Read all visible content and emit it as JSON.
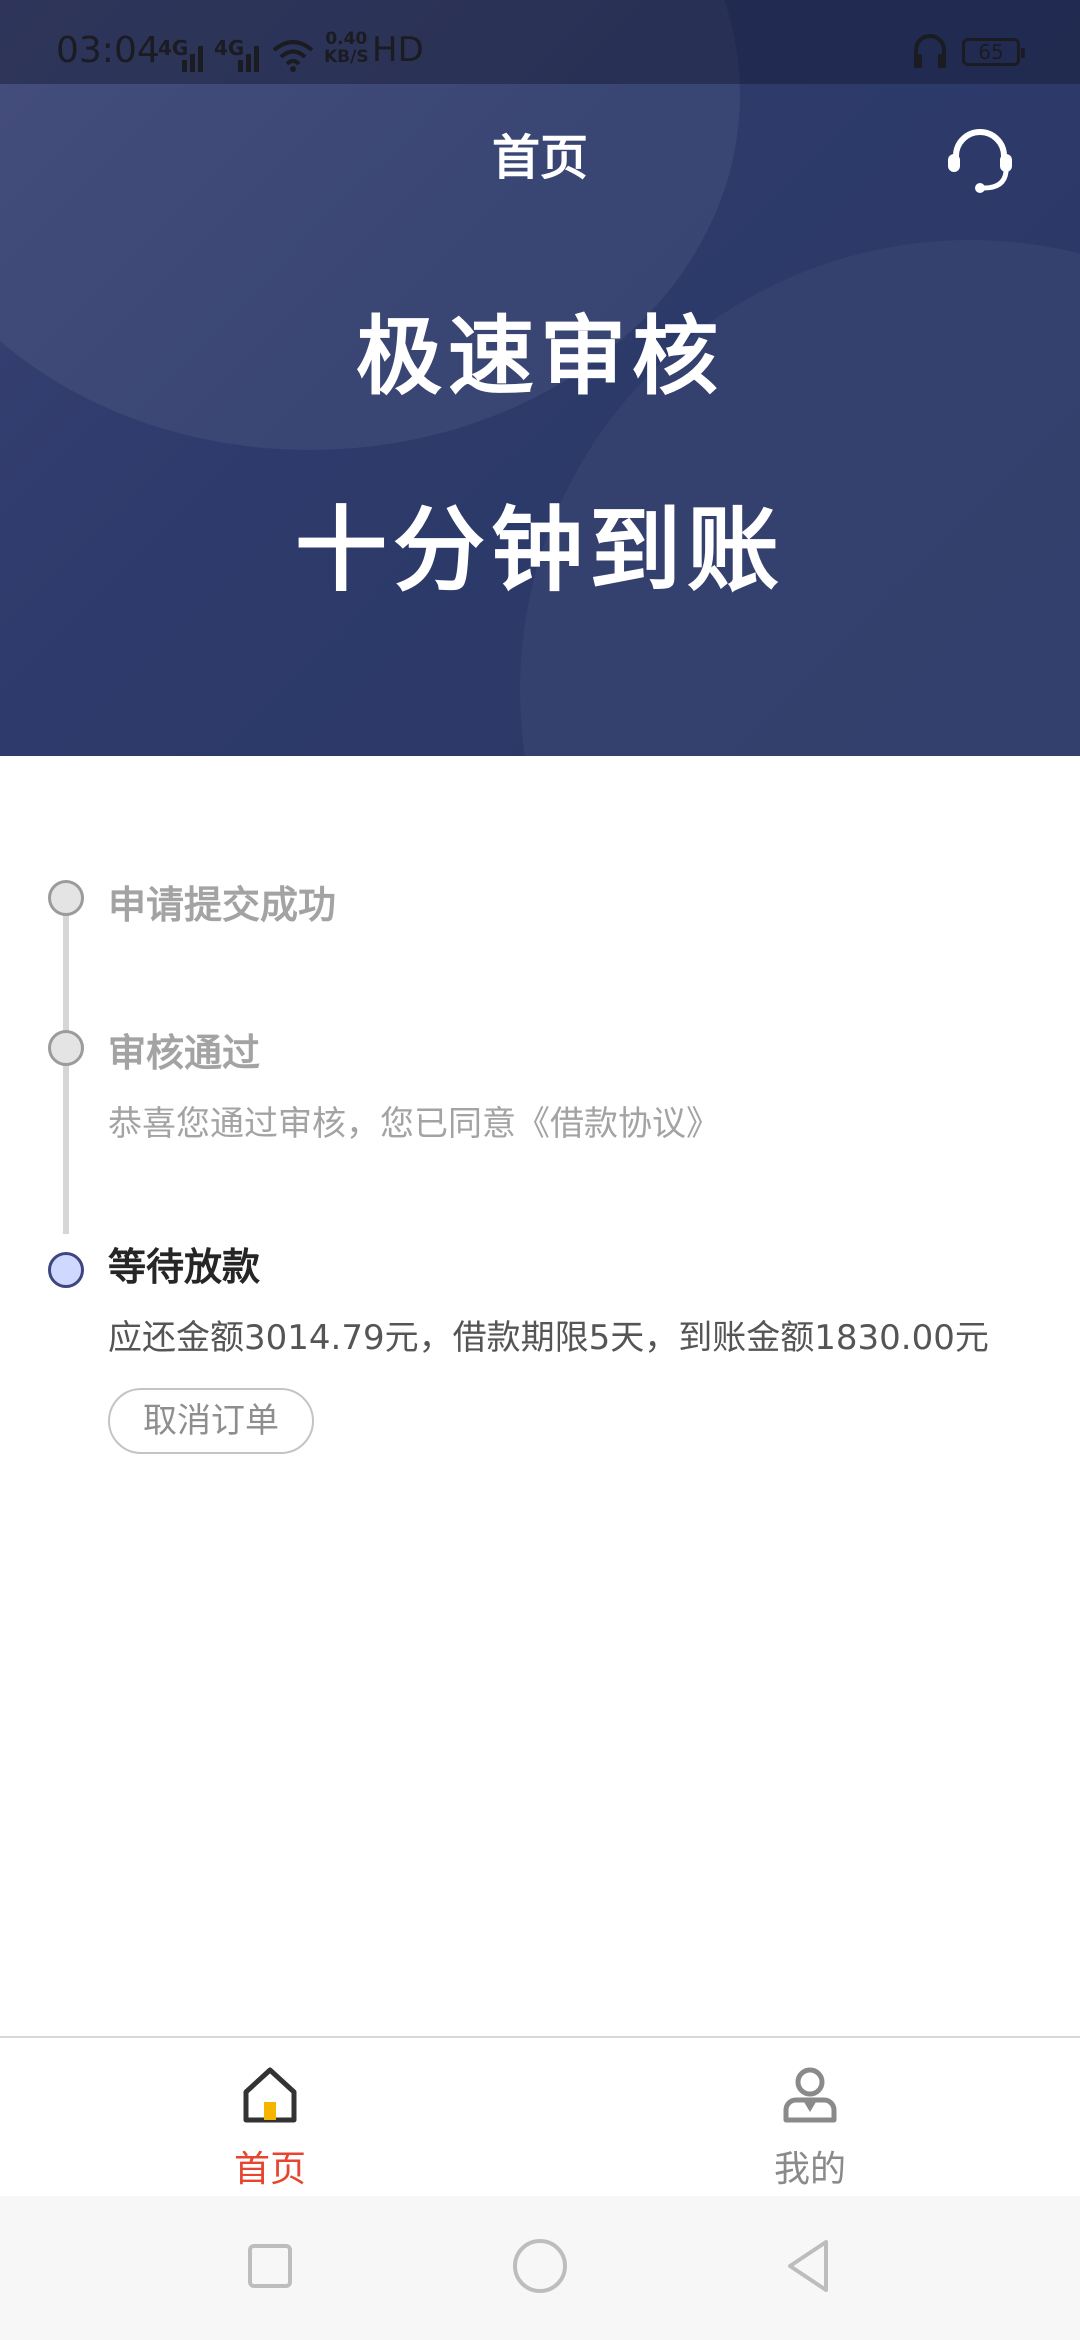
{
  "status_bar": {
    "time": "03:04",
    "signal1": "4G",
    "signal2": "4G",
    "net_speed_value": "0.40",
    "net_speed_unit": "KB/S",
    "hd": "HD",
    "battery": "65",
    "icons": [
      "signal-icon",
      "wifi-icon",
      "headphones-icon",
      "battery-icon"
    ]
  },
  "header": {
    "title": "首页",
    "support_icon": "customer-service-icon"
  },
  "banner": {
    "line1": "极速审核",
    "line2": "十分钟到账"
  },
  "timeline": {
    "steps": [
      {
        "title": "申请提交成功",
        "desc": ""
      },
      {
        "title": "审核通过",
        "desc": "恭喜您通过审核，您已同意《借款协议》"
      },
      {
        "title": "等待放款",
        "desc": "应还金额3014.79元，借款期限5天，到账金额1830.00元",
        "action": "取消订单"
      }
    ]
  },
  "tabbar": {
    "items": [
      {
        "label": "首页",
        "icon": "home-icon",
        "active": true
      },
      {
        "label": "我的",
        "icon": "profile-icon",
        "active": false
      }
    ]
  },
  "nav": {
    "icons": [
      "recents-icon",
      "home-circle-icon",
      "back-icon"
    ]
  },
  "colors": {
    "banner": "#2d3a6b",
    "active_tab": "#e8452e",
    "inactive_tab": "#8a8a8a",
    "active_dot": "#cfd9ff"
  }
}
